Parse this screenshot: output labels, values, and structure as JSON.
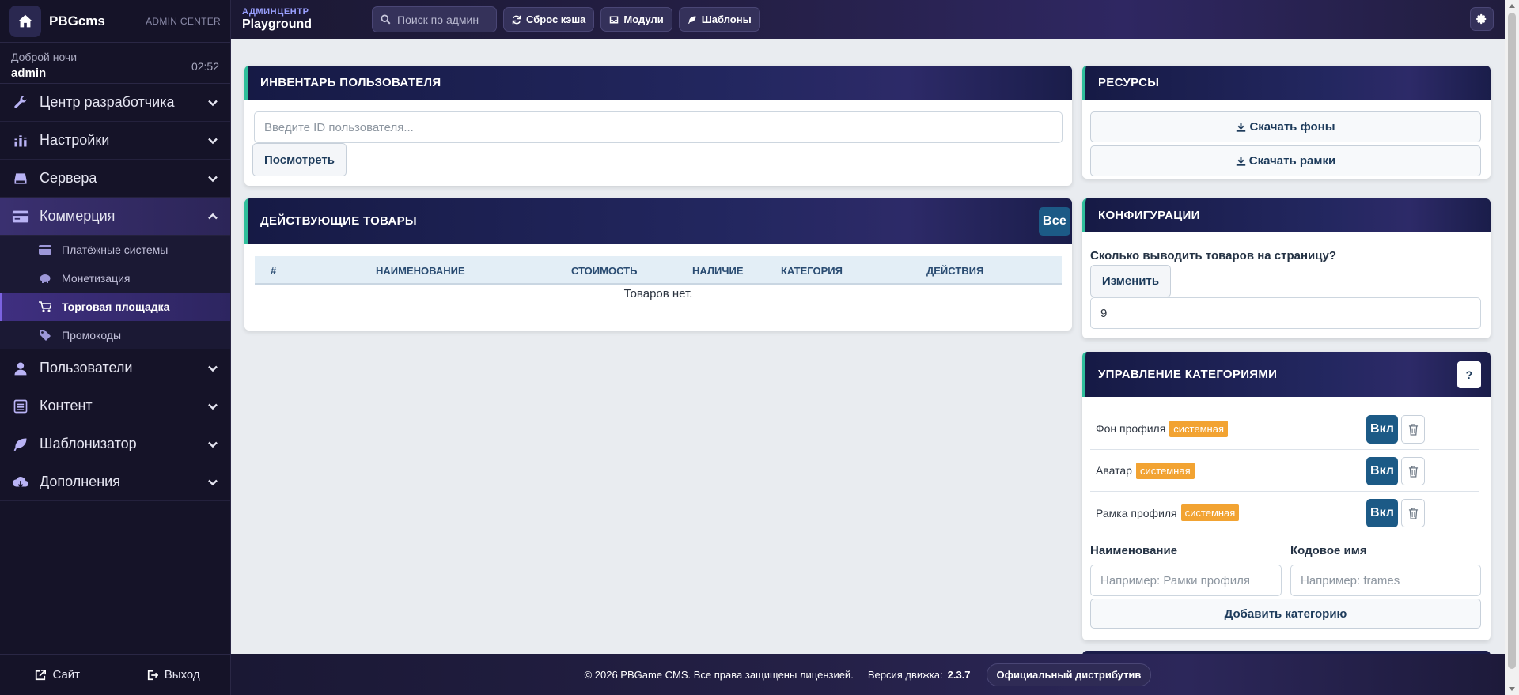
{
  "brand": {
    "name": "PBGcms",
    "sub": "ADMIN CENTER"
  },
  "user": {
    "greeting": "Доброй ночи",
    "name": "admin",
    "time": "02:52"
  },
  "sidebar": {
    "items": [
      {
        "label": "Центр разработчика",
        "icon": "wrench-icon"
      },
      {
        "label": "Настройки",
        "icon": "sliders-icon"
      },
      {
        "label": "Сервера",
        "icon": "server-icon"
      },
      {
        "label": "Коммерция",
        "icon": "credit-card-icon"
      },
      {
        "label": "Пользователи",
        "icon": "user-icon"
      },
      {
        "label": "Контент",
        "icon": "list-icon"
      },
      {
        "label": "Шаблонизатор",
        "icon": "leaf-icon"
      },
      {
        "label": "Дополнения",
        "icon": "cloud-download-icon"
      }
    ],
    "commerce_sub": [
      {
        "label": "Платёжные системы",
        "icon": "card-icon"
      },
      {
        "label": "Монетизация",
        "icon": "piggy-bank-icon"
      },
      {
        "label": "Торговая площадка",
        "icon": "cart-icon"
      },
      {
        "label": "Промокоды",
        "icon": "tag-icon"
      }
    ],
    "footer": {
      "site": "Сайт",
      "logout": "Выход"
    }
  },
  "topbar": {
    "small": "АДМИНЦЕНТР",
    "title": "Playground",
    "search_placeholder": "Поиск по админ",
    "cache": "Сброс кэша",
    "modules": "Модули",
    "templates": "Шаблоны"
  },
  "inventory": {
    "title": "ИНВЕНТАРЬ ПОЛЬЗОВАТЕЛЯ",
    "placeholder": "Введите ID пользователя...",
    "view": "Посмотреть"
  },
  "goods": {
    "title": "ДЕЙСТВУЮЩИЕ ТОВАРЫ",
    "all": "Все",
    "columns": [
      "#",
      "НАИМЕНОВАНИЕ",
      "СТОИМОСТЬ",
      "НАЛИЧИЕ",
      "КАТЕГОРИЯ",
      "ДЕЙСТВИЯ"
    ],
    "empty": "Товаров нет."
  },
  "resources": {
    "title": "РЕСУРСЫ",
    "bg": "Скачать фоны",
    "frames": "Скачать рамки"
  },
  "config": {
    "title": "КОНФИГУРАЦИИ",
    "question": "Сколько выводить товаров на страницу?",
    "change": "Изменить",
    "value": "9"
  },
  "categories": {
    "title": "УПРАВЛЕНИЕ КАТЕГОРИЯМИ",
    "help": "?",
    "rows": [
      {
        "name": "Фон профиля",
        "badge": "системная",
        "on": "Вкл"
      },
      {
        "name": "Аватар",
        "badge": "системная",
        "on": "Вкл"
      },
      {
        "name": "Рамка профиля",
        "badge": "системная",
        "on": "Вкл"
      }
    ],
    "name_label": "Наименование",
    "code_label": "Кодовое имя",
    "name_placeholder": "Например: Рамки профиля",
    "code_placeholder": "Например: frames",
    "add": "Добавить категорию"
  },
  "footer": {
    "copyright": "© 2026 PBGame CMS. Все права защищены лицензией.",
    "version_label": "Версия движка:",
    "version": "2.3.7",
    "dist": "Официальный дистрибутив"
  }
}
